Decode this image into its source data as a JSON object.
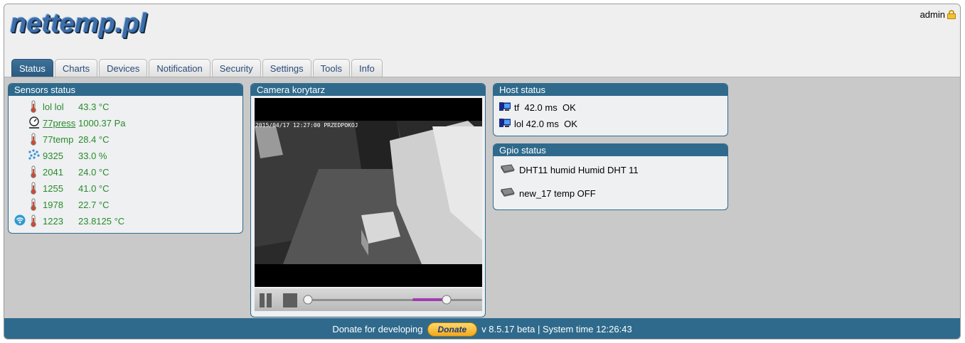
{
  "logo": {
    "text": "nettemp.pl"
  },
  "user": {
    "name": "admin",
    "lock_icon": "lock-icon"
  },
  "tabs": [
    {
      "label": "Status",
      "active": true
    },
    {
      "label": "Charts"
    },
    {
      "label": "Devices"
    },
    {
      "label": "Notification"
    },
    {
      "label": "Security"
    },
    {
      "label": "Settings"
    },
    {
      "label": "Tools"
    },
    {
      "label": "Info"
    }
  ],
  "sensors": {
    "title": "Sensors status",
    "rows": [
      {
        "icon": "thermometer-icon",
        "name": "lol lol",
        "value": "43.3 °C"
      },
      {
        "icon": "pressure-gauge-icon",
        "name": "77press",
        "value": "1000.37 Pa"
      },
      {
        "icon": "thermometer-icon",
        "name": "77temp",
        "value": "28.4 °C"
      },
      {
        "icon": "humidity-icon",
        "name": "9325",
        "value": "33.0  %"
      },
      {
        "icon": "thermometer-icon",
        "name": "2041",
        "value": "24.0 °C"
      },
      {
        "icon": "thermometer-icon",
        "name": "1255",
        "value": "41.0 °C"
      },
      {
        "icon": "thermometer-icon",
        "name": "1978",
        "value": "22.7 °C"
      },
      {
        "icon": "thermometer-icon",
        "name": "1223",
        "value": "23.8125 °C",
        "wireless": true
      }
    ]
  },
  "camera": {
    "title": "Camera korytarz",
    "timestamp": "2015/04/17 12:27:00 PRZEDPOKOJ",
    "progress": 0.02,
    "volume": 0.75
  },
  "host": {
    "title": "Host status",
    "rows": [
      {
        "name": "tf",
        "ping": "42.0 ms",
        "status": "OK"
      },
      {
        "name": "lol",
        "ping": "42.0 ms",
        "status": "OK"
      }
    ]
  },
  "gpio": {
    "title": "Gpio status",
    "rows": [
      {
        "label": "DHT11 humid Humid DHT 11"
      },
      {
        "label": "new_17 temp OFF"
      }
    ]
  },
  "footer": {
    "prefix": "Donate for developing",
    "donate_label": "Donate",
    "suffix": "v 8.5.17 beta | System time 12:26:43"
  },
  "colors": {
    "accent": "#2f6a8c",
    "sensor_text": "#2a8a2a",
    "content_bg": "#c9c9c9"
  }
}
